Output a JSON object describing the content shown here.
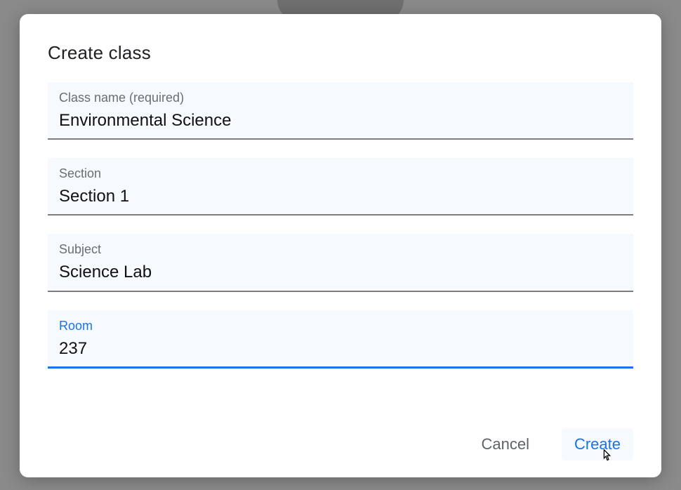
{
  "dialog": {
    "title": "Create class",
    "fields": {
      "class_name": {
        "label": "Class name (required)",
        "value": "Environmental Science"
      },
      "section": {
        "label": "Section",
        "value": "Section 1"
      },
      "subject": {
        "label": "Subject",
        "value": "Science Lab"
      },
      "room": {
        "label": "Room",
        "value": "237"
      }
    },
    "actions": {
      "cancel": "Cancel",
      "create": "Create"
    }
  }
}
